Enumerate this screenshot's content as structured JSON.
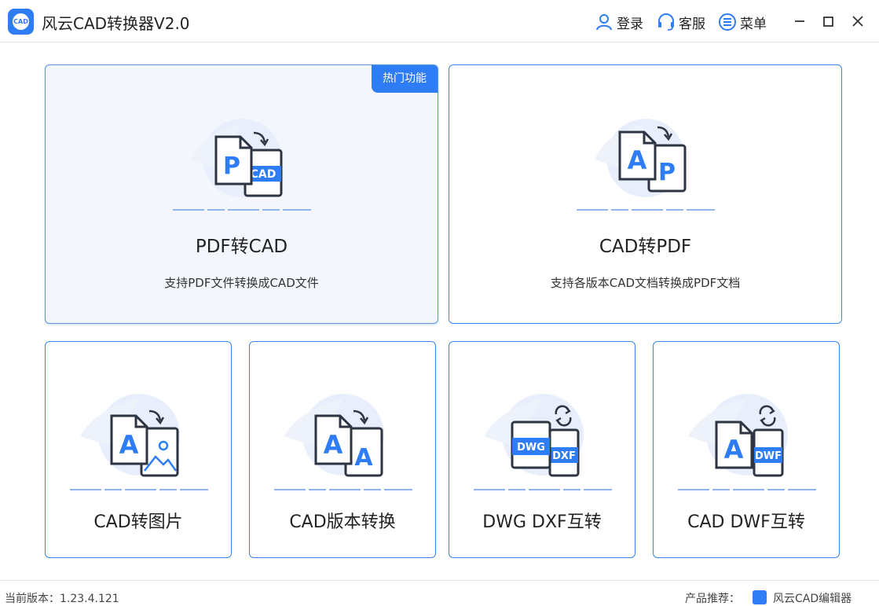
{
  "app": {
    "logo_text": "CAD",
    "title": "风云CAD转换器V2.0"
  },
  "header": {
    "login_label": "登录",
    "service_label": "客服",
    "menu_label": "菜单"
  },
  "cards": {
    "pdf_to_cad": {
      "badge": "热门功能",
      "title": "PDF转CAD",
      "desc": "支持PDF文件转换成CAD文件",
      "icon_front": "P",
      "icon_back": "CAD"
    },
    "cad_to_pdf": {
      "title": "CAD转PDF",
      "desc": "支持各版本CAD文档转换成PDF文档",
      "icon_front": "A",
      "icon_back": "P"
    },
    "cad_to_image": {
      "title": "CAD转图片",
      "icon_front": "A"
    },
    "cad_version": {
      "title": "CAD版本转换",
      "icon_front": "A",
      "icon_back": "A"
    },
    "dwg_dxf": {
      "title": "DWG DXF互转",
      "icon_front": "DWG",
      "icon_back": "DXF"
    },
    "cad_dwf": {
      "title": "CAD DWF互转",
      "icon_front": "A",
      "icon_back": "DWF"
    }
  },
  "status": {
    "version": "当前版本：1.23.4.121",
    "recommend": "产品推荐：",
    "product": "风云CAD编辑器"
  },
  "colors": {
    "accent": "#2e7cf6",
    "border": "#3b86e8",
    "active_bg": "#f3f6fc",
    "icon_dark": "#2d3442"
  }
}
